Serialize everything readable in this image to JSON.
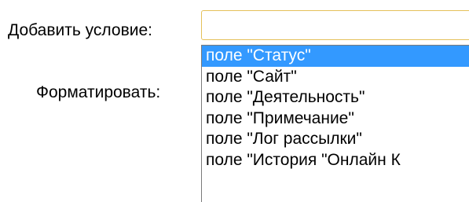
{
  "form": {
    "add_condition_label": "Добавить условие:",
    "format_label": "Форматировать:",
    "add_condition_select": {
      "value": ""
    }
  },
  "dropdown": {
    "options": [
      "поле \"Статус\"",
      "поле \"Сайт\"",
      "поле \"Деятельность\"",
      "поле \"Примечание\"",
      "поле \"Лог рассылки\"",
      "поле \"История \"Онлайн К"
    ],
    "selected_index": 0
  },
  "colors": {
    "selection": "#3399ff",
    "focused_border": "#e5c15a"
  }
}
